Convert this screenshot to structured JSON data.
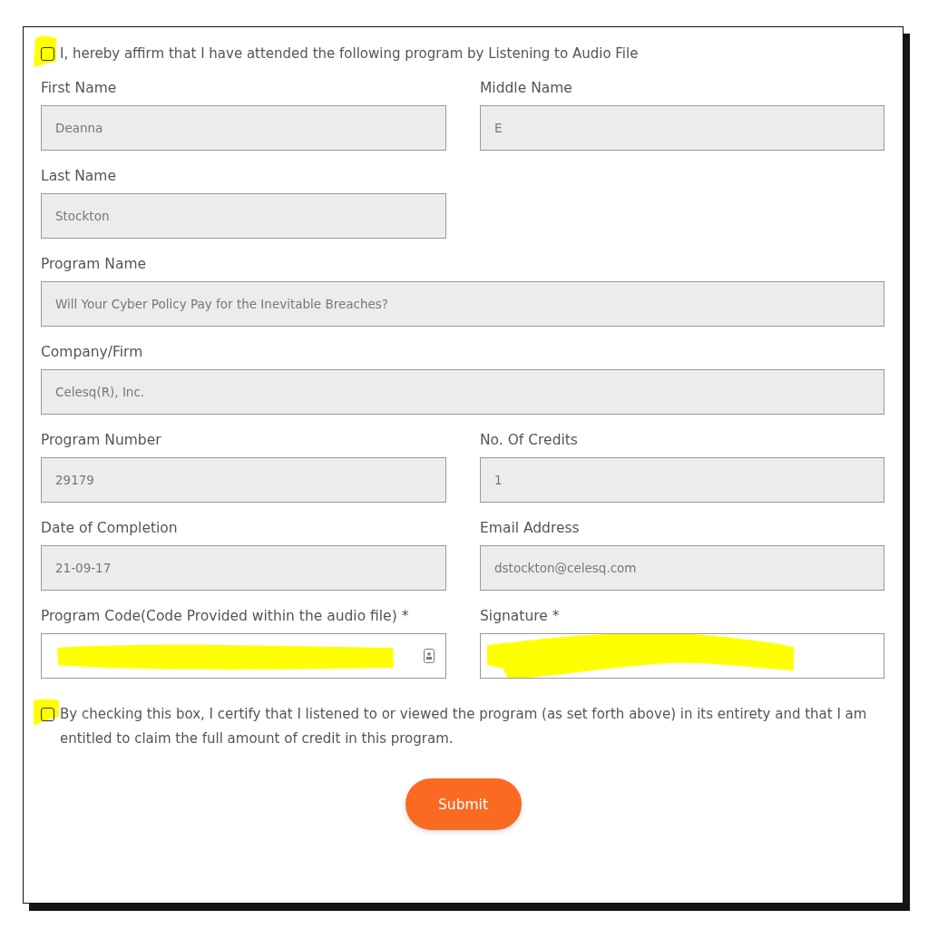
{
  "affirm": {
    "text": "I, hereby affirm that I have attended the following program by Listening to Audio File",
    "checked": false
  },
  "rows": [
    {
      "fields": [
        {
          "label": "First Name",
          "value": "Deanna",
          "disabled": true
        },
        {
          "label": "Middle Name",
          "value": "E",
          "disabled": true
        }
      ]
    },
    {
      "fields": [
        {
          "label": "Last Name",
          "value": "Stockton",
          "disabled": true
        }
      ]
    },
    {
      "fields": [
        {
          "label": "Program Name",
          "value": "Will Your Cyber Policy Pay for the Inevitable Breaches?",
          "disabled": true,
          "wide": true
        }
      ]
    },
    {
      "fields": [
        {
          "label": "Company/Firm",
          "value": "Celesq(R), Inc.",
          "disabled": true,
          "wide": true
        }
      ]
    },
    {
      "fields": [
        {
          "label": "Program Number",
          "value": "29179",
          "disabled": true
        },
        {
          "label": "No. Of Credits",
          "value": "1",
          "disabled": true
        }
      ]
    },
    {
      "fields": [
        {
          "label": "Date of Completion",
          "value": "21-09-17",
          "disabled": true
        },
        {
          "label": "Email Address",
          "value": "dstockton@celesq.com",
          "disabled": true
        }
      ]
    },
    {
      "fields": [
        {
          "label": "Program Code(Code Provided within the audio file) *",
          "disabled": false,
          "kind": "code"
        },
        {
          "label": "Signature *",
          "disabled": false,
          "kind": "signature"
        }
      ]
    }
  ],
  "certify": {
    "text": "By checking this box, I certify that I listened to or viewed the program (as set forth above) in its entirety and that I am entitled to claim the full amount of credit in this program.",
    "checked": false
  },
  "submit": "Submit"
}
